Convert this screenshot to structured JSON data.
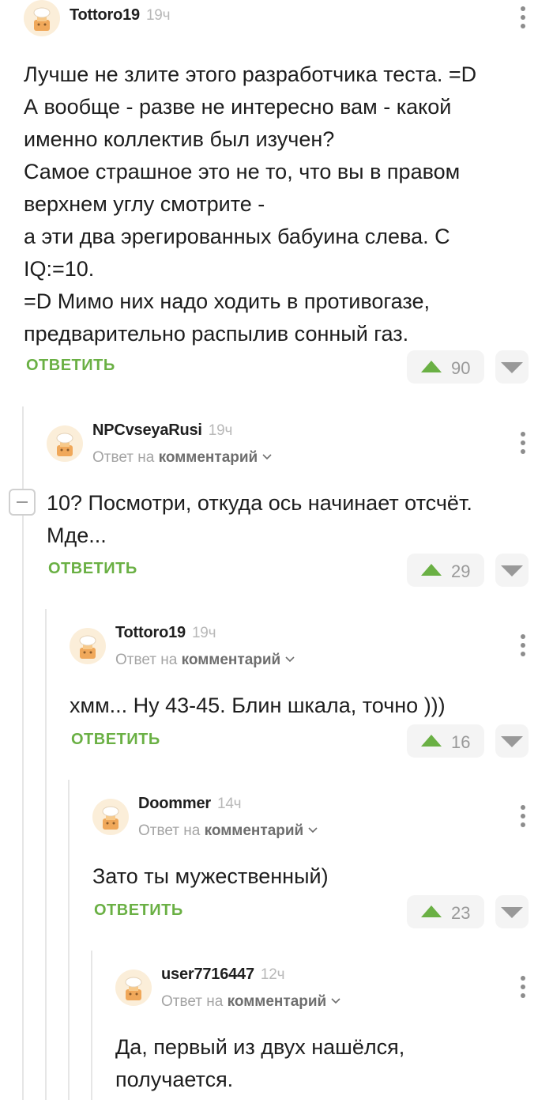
{
  "comments": [
    {
      "username": "Tottoro19",
      "time": "19ч",
      "reply_prefix": "",
      "reply_target": "",
      "text": "Лучше не злите этого разработчика теста. =D\nА вообще - разве не интересно вам - какой именно коллектив был изучен?\nСамое страшное это не то, что вы в правом верхнем углу смотрите -\nа эти два эрегированных бабуина слева. С IQ:=10.\n=D Мимо них надо ходить в противогазе, предварительно распылив сонный газ.",
      "reply_label": "ОТВЕТИТЬ",
      "rating": "90"
    },
    {
      "username": "NPCvseyaRusi",
      "time": "19ч",
      "reply_prefix": "Ответ на",
      "reply_target": "комментарий",
      "text": "10? Посмотри, откуда ось начинает отсчёт. Мде...",
      "reply_label": "ОТВЕТИТЬ",
      "rating": "29"
    },
    {
      "username": "Tottoro19",
      "time": "19ч",
      "reply_prefix": "Ответ на",
      "reply_target": "комментарий",
      "text": "хмм... Ну 43-45. Блин шкала, точно )))",
      "reply_label": "ОТВЕТИТЬ",
      "rating": "16"
    },
    {
      "username": "Doommer",
      "time": "14ч",
      "reply_prefix": "Ответ на",
      "reply_target": "комментарий",
      "text": "Зато ты мужественный)",
      "reply_label": "ОТВЕТИТЬ",
      "rating": "23"
    },
    {
      "username": "user7716447",
      "time": "12ч",
      "reply_prefix": "Ответ на",
      "reply_target": "комментарий",
      "text": "Да, первый из двух нашёлся, получается.",
      "reply_label": "",
      "rating": ""
    }
  ],
  "icons": {
    "avatar": "default-avatar-icon",
    "more": "more-vertical-icon",
    "upvote": "upvote-icon",
    "downvote": "downvote-icon",
    "chevron": "chevron-down-icon",
    "collapse": "collapse-thread-icon"
  },
  "colors": {
    "accent_green": "#6ab044",
    "avatar_bg": "#fbeed9",
    "vote_bg": "#f4f4f4",
    "muted_text": "#a4a4a4"
  }
}
